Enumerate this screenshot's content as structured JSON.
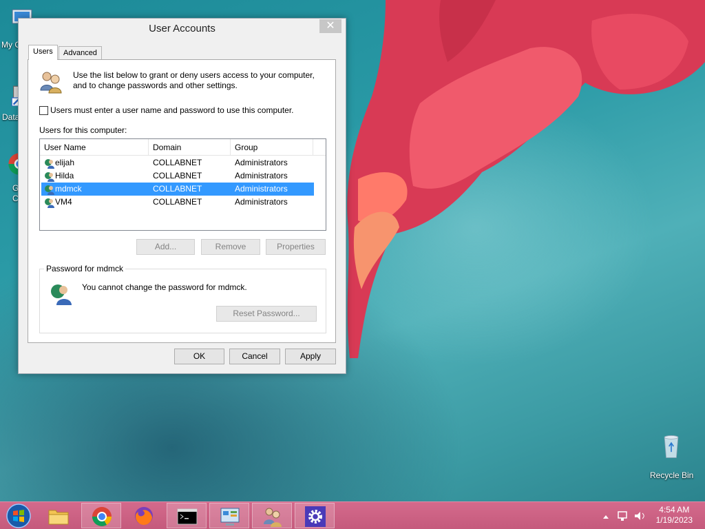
{
  "desktop": {
    "icons": [
      {
        "label": "My C",
        "icon": "computer-icon"
      },
      {
        "label": "Data",
        "icon": "database-shortcut-icon"
      },
      {
        "label": "G",
        "label2": "C",
        "icon": "chrome-shortcut-icon"
      },
      {
        "label": "Recycle Bin",
        "icon": "recycle-bin-icon"
      }
    ]
  },
  "dialog": {
    "title": "User Accounts",
    "close_glyph": "✕",
    "tabs": [
      {
        "label": "Users",
        "active": true
      },
      {
        "label": "Advanced",
        "active": false
      }
    ],
    "intro_text": "Use the list below to grant or deny users access to your computer, and to change passwords and other settings.",
    "require_login_label": "Users must enter a user name and password to use this computer.",
    "require_login_checked": false,
    "users_label": "Users for this computer:",
    "columns": [
      "User Name",
      "Domain",
      "Group"
    ],
    "users": [
      {
        "name": "elijah",
        "domain": "COLLABNET",
        "group": "Administrators",
        "selected": false
      },
      {
        "name": "Hilda",
        "domain": "COLLABNET",
        "group": "Administrators",
        "selected": false
      },
      {
        "name": "mdmck",
        "domain": "COLLABNET",
        "group": "Administrators",
        "selected": true
      },
      {
        "name": "VM4",
        "domain": "COLLABNET",
        "group": "Administrators",
        "selected": false
      }
    ],
    "buttons": {
      "add": "Add...",
      "remove": "Remove",
      "properties": "Properties"
    },
    "password_group_label": "Password for mdmck",
    "password_message": "You cannot change the password for mdmck.",
    "reset_password": "Reset Password...",
    "ok": "OK",
    "cancel": "Cancel",
    "apply": "Apply"
  },
  "taskbar": {
    "items": [
      {
        "icon": "file-explorer-icon",
        "open": false
      },
      {
        "icon": "chrome-icon",
        "open": true
      },
      {
        "icon": "firefox-icon",
        "open": false
      },
      {
        "icon": "command-prompt-icon",
        "open": true
      },
      {
        "icon": "control-panel-icon",
        "open": true
      },
      {
        "icon": "user-accounts-icon",
        "open": true
      },
      {
        "icon": "settings-gear-icon",
        "open": true
      }
    ],
    "time": "4:54 AM",
    "date": "1/19/2023"
  },
  "colors": {
    "selection": "#3399ff",
    "taskbar": "#c55a7c",
    "wallpaper": "#2a9aa6"
  }
}
